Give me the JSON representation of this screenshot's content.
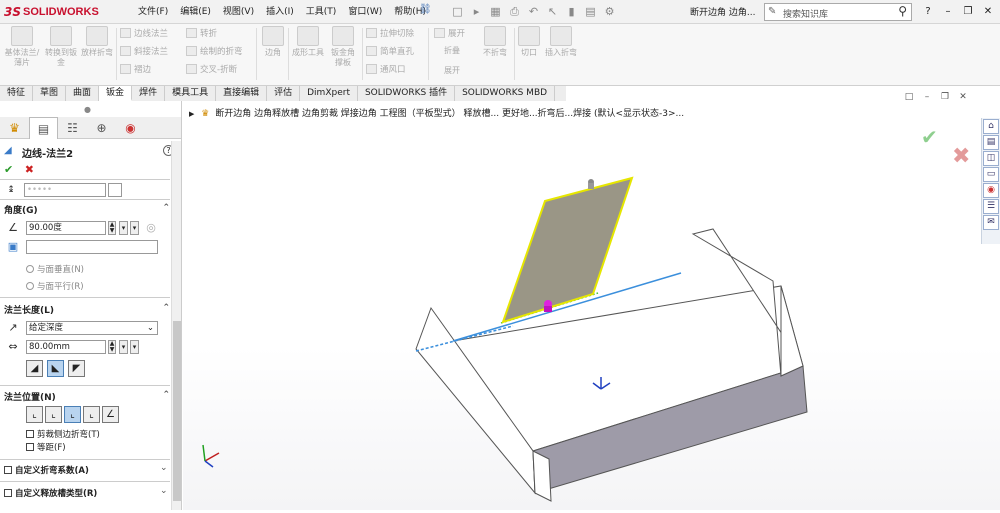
{
  "app": {
    "ds_mark": "3S",
    "brand": "SOLIDWORKS"
  },
  "menu": [
    "文件(F)",
    "编辑(E)",
    "视图(V)",
    "插入(I)",
    "工具(T)",
    "窗口(W)",
    "帮助(H)"
  ],
  "doc_title": "断开边角 边角...",
  "search": {
    "placeholder": "搜索知识库"
  },
  "ribbon": {
    "big": [
      "基体法兰/薄片",
      "转换到钣金",
      "放样折弯",
      "边角",
      "成形工具",
      "钣金角撑板",
      "展开",
      "折叠",
      "不折弯",
      "切口",
      "插入折弯"
    ],
    "small": [
      "边线法兰",
      "斜接法兰",
      "褶边",
      "转折",
      "绘制的折弯",
      "交叉-折断",
      "拉伸切除",
      "简单直孔",
      "通风口",
      "展开"
    ]
  },
  "tabs": [
    "特征",
    "草图",
    "曲面",
    "钣金",
    "焊件",
    "模具工具",
    "直接编辑",
    "评估",
    "DimXpert",
    "SOLIDWORKS 插件",
    "SOLIDWORKS MBD"
  ],
  "active_tab": "钣金",
  "breadcrumb": "断开边角 边角释放槽 边角剪裁 焊接边角 工程图（平板型式） 释放槽... 更好地...折弯后...焊接 (默认<显示状态-3>...",
  "panel": {
    "feature_title": "边线-法兰2",
    "sections": {
      "angle": "角度(G)",
      "length": "法兰长度(L)",
      "position": "法兰位置(N)",
      "custom_bend": "自定义折弯系数(A)",
      "custom_relief": "自定义释放槽类型(R)"
    },
    "angle_value": "90.00度",
    "radio_perpendicular": "与面垂直(N)",
    "radio_parallel": "与面平行(R)",
    "length_type": "给定深度",
    "length_value": "80.00mm",
    "trim_side_bends": "剪裁侧边折弯(T)",
    "offset": "等距(F)"
  },
  "colors": {
    "accent": "#c8102e",
    "flange_outline": "#e6e600",
    "highlight_edge": "#3b8fdc",
    "part_face": "#9e9ba8"
  }
}
